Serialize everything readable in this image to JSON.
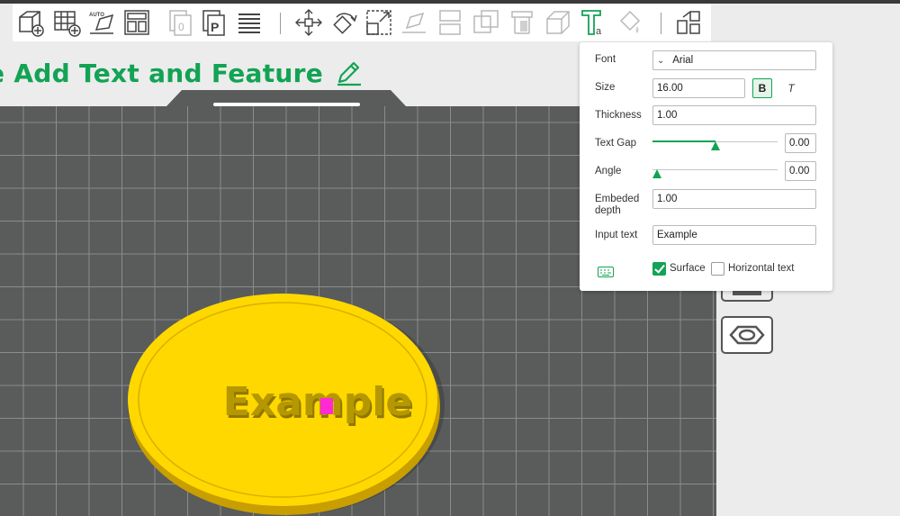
{
  "colors": {
    "accent": "#12a354",
    "plate": "#5a5d5c",
    "grid": "#8a8d8b",
    "coin": "#ffd800",
    "coin_rim": "#d4a900",
    "text_face": "#b89a00",
    "marker": "#ff2ad1"
  },
  "toolbar": {
    "icons": [
      "add-cube-icon",
      "add-plate-icon",
      "auto-orient-icon",
      "arrange-icon",
      "copy-icon",
      "place-plate-icon",
      "layers-icon",
      "move-icon",
      "rotate-icon",
      "scale-icon",
      "lay-on-face-icon",
      "cut-icon",
      "boolean-icon",
      "support-paint-icon",
      "seam-paint-icon",
      "text-tool-icon",
      "color-paint-icon",
      "assembly-icon"
    ]
  },
  "plate": {
    "title": "e Add Text and Feature"
  },
  "model": {
    "embossed_text": "Example"
  },
  "panel": {
    "font_label": "Font",
    "font_value": "Arial",
    "size_label": "Size",
    "size_value": "16.00",
    "bold_label": "B",
    "italic_label": "T",
    "thickness_label": "Thickness",
    "thickness_value": "1.00",
    "text_gap_label": "Text Gap",
    "text_gap_value": "0.00",
    "text_gap_slider": 0.5,
    "angle_label": "Angle",
    "angle_value": "0.00",
    "angle_slider": 0.0,
    "embeded_depth_label_1": "Embeded",
    "embeded_depth_label_2": "depth",
    "embeded_depth_value": "1.00",
    "input_text_label": "Input text",
    "input_text_value": "Example",
    "surface_label": "Surface",
    "surface_checked": true,
    "horizontal_label": "Horizontal text",
    "horizontal_checked": false
  }
}
